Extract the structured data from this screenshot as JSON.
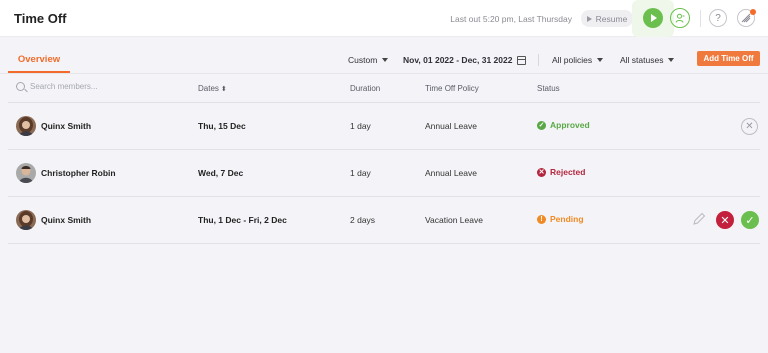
{
  "header": {
    "title": "Time Off",
    "last_out": "Last out 5:20 pm, Last Thursday",
    "resume_label": "Resume"
  },
  "tabs": {
    "overview": "Overview"
  },
  "filters": {
    "range_type": "Custom",
    "date_range": "Nov, 01 2022 - Dec, 31 2022",
    "policies": "All policies",
    "statuses": "All statuses",
    "add_button": "Add Time Off"
  },
  "table": {
    "search_placeholder": "Search members...",
    "columns": {
      "dates": "Dates",
      "duration": "Duration",
      "policy": "Time Off Policy",
      "status": "Status"
    },
    "rows": [
      {
        "member": "Quinx Smith",
        "dates": "Thu, 15 Dec",
        "duration": "1 day",
        "policy": "Annual Leave",
        "status": "Approved"
      },
      {
        "member": "Christopher Robin",
        "dates": "Wed, 7 Dec",
        "duration": "1 day",
        "policy": "Annual Leave",
        "status": "Rejected"
      },
      {
        "member": "Quinx Smith",
        "dates": "Thu, 1 Dec - Fri, 2 Dec",
        "duration": "2 days",
        "policy": "Vacation Leave",
        "status": "Pending"
      }
    ]
  },
  "colors": {
    "accent": "#f26b2a",
    "approved": "#5aa845",
    "rejected": "#b3263e",
    "pending": "#f08a24",
    "play": "#6bbf4e"
  },
  "icons": [
    "search-icon",
    "calendar-icon",
    "sort-icon",
    "play-icon",
    "user-status-icon",
    "help-icon",
    "notification-icon",
    "cancel-icon",
    "edit-icon",
    "reject-icon",
    "approve-icon"
  ]
}
